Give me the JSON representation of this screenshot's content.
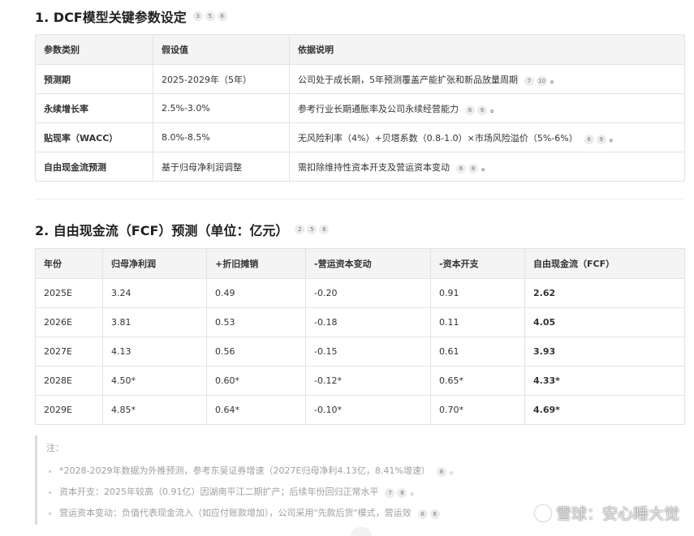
{
  "section1": {
    "title": "1. DCF模型关键参数设定",
    "cites": [
      "3",
      "5",
      "6"
    ],
    "headers": [
      "参数类别",
      "假设值",
      "依据说明"
    ],
    "rows": [
      {
        "cat": "预测期",
        "val": "2025-2029年（5年）",
        "desc": "公司处于成长期，5年预测覆盖产能扩张和新品放量周期",
        "cites": [
          "7",
          "10"
        ],
        "tail": "。"
      },
      {
        "cat": "永续增长率",
        "val": "2.5%-3.0%",
        "desc": "参考行业长期通胀率及公司永续经营能力",
        "cites": [
          "6",
          "9"
        ],
        "tail": "。"
      },
      {
        "cat": "贴现率（WACC）",
        "val": "8.0%-8.5%",
        "desc": "无风险利率（4%）+贝塔系数（0.8-1.0）×市场风险溢价（5%-6%）",
        "cites": [
          "6",
          "9"
        ],
        "tail": "。"
      },
      {
        "cat": "自由现金流预测",
        "val": "基于归母净利润调整",
        "desc": "需扣除维持性资本开支及营运资本变动",
        "cites": [
          "6",
          "8"
        ],
        "tail": "。"
      }
    ]
  },
  "section2": {
    "title": "2. 自由现金流（FCF）预测（单位：亿元）",
    "cites": [
      "2",
      "5",
      "8"
    ],
    "headers": [
      "年份",
      "归母净利润",
      "+折旧摊销",
      "-营运资本变动",
      "-资本开支",
      "自由现金流（FCF）"
    ],
    "rows": [
      [
        "2025E",
        "3.24",
        "0.49",
        "-0.20",
        "0.91",
        "2.62"
      ],
      [
        "2026E",
        "3.81",
        "0.53",
        "-0.18",
        "0.11",
        "4.05"
      ],
      [
        "2027E",
        "4.13",
        "0.56",
        "-0.15",
        "0.61",
        "3.93"
      ],
      [
        "2028E",
        "4.50*",
        "0.60*",
        "-0.12*",
        "0.65*",
        "4.33*"
      ],
      [
        "2029E",
        "4.85*",
        "0.64*",
        "-0.10*",
        "0.70*",
        "4.69*"
      ]
    ]
  },
  "notes": {
    "title": "注：",
    "items": [
      {
        "text": "*2028-2029年数据为外推预测，参考东吴证券增速（2027E归母净利4.13亿，8.41%增速）",
        "cites": [
          "8"
        ],
        "tail": "。"
      },
      {
        "text": "资本开支：2025年较高（0.91亿）因湖南平江二期扩产；后续年份回归正常水平",
        "cites": [
          "7",
          "8"
        ],
        "tail": "。"
      },
      {
        "text": "营运资本变动：负值代表现金流入（如应付账款增加），公司采用\"先款后货\"模式，营运效",
        "cites": [
          "6",
          "8"
        ],
        "tail": ""
      }
    ]
  },
  "watermark": {
    "text": "雪球：安心睡大觉"
  }
}
